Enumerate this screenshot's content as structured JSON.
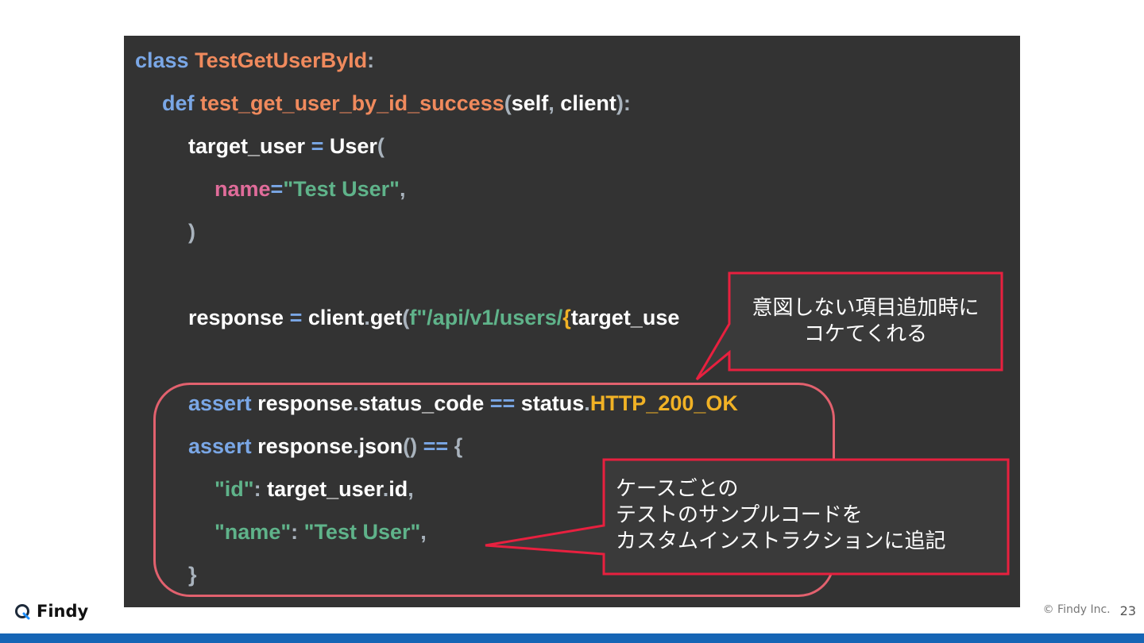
{
  "code": {
    "lines": [
      [
        {
          "t": "class ",
          "c": "kw"
        },
        {
          "t": "TestGetUserById",
          "c": "name"
        },
        {
          "t": ":",
          "c": "pun"
        }
      ],
      [
        {
          "t": "def ",
          "c": "kw"
        },
        {
          "t": "test_get_user_by_id_success",
          "c": "name"
        },
        {
          "t": "(",
          "c": "pun"
        },
        {
          "t": "self",
          "c": "wht"
        },
        {
          "t": ", ",
          "c": "pun"
        },
        {
          "t": "client",
          "c": "wht"
        },
        {
          "t": "):",
          "c": "pun"
        }
      ],
      [
        {
          "t": "target_user ",
          "c": "wht"
        },
        {
          "t": "= ",
          "c": "kw"
        },
        {
          "t": "User",
          "c": "wht"
        },
        {
          "t": "(",
          "c": "pun"
        }
      ],
      [
        {
          "t": "name",
          "c": "pink"
        },
        {
          "t": "=",
          "c": "kw"
        },
        {
          "t": "\"Test User\"",
          "c": "str"
        },
        {
          "t": ",",
          "c": "pun"
        }
      ],
      [
        {
          "t": ")",
          "c": "pun"
        }
      ],
      [],
      [
        {
          "t": "response ",
          "c": "wht"
        },
        {
          "t": "= ",
          "c": "kw"
        },
        {
          "t": "client",
          "c": "wht"
        },
        {
          "t": ".",
          "c": "pun"
        },
        {
          "t": "get",
          "c": "wht"
        },
        {
          "t": "(",
          "c": "pun"
        },
        {
          "t": "f\"/api/v1/users/",
          "c": "str"
        },
        {
          "t": "{",
          "c": "yel"
        },
        {
          "t": "target_use",
          "c": "wht"
        }
      ],
      [],
      [
        {
          "t": "assert ",
          "c": "kw"
        },
        {
          "t": "response",
          "c": "wht"
        },
        {
          "t": ".",
          "c": "pun"
        },
        {
          "t": "status_code ",
          "c": "wht"
        },
        {
          "t": "== ",
          "c": "kw"
        },
        {
          "t": "status",
          "c": "wht"
        },
        {
          "t": ".",
          "c": "pun"
        },
        {
          "t": "HTTP_200_OK",
          "c": "yel"
        }
      ],
      [
        {
          "t": "assert ",
          "c": "kw"
        },
        {
          "t": "response",
          "c": "wht"
        },
        {
          "t": ".",
          "c": "pun"
        },
        {
          "t": "json",
          "c": "wht"
        },
        {
          "t": "() ",
          "c": "pun"
        },
        {
          "t": "== ",
          "c": "kw"
        },
        {
          "t": "{",
          "c": "pun"
        }
      ],
      [
        {
          "t": "\"id\"",
          "c": "str"
        },
        {
          "t": ": ",
          "c": "pun"
        },
        {
          "t": "target_user",
          "c": "wht"
        },
        {
          "t": ".",
          "c": "pun"
        },
        {
          "t": "id",
          "c": "wht"
        },
        {
          "t": ",",
          "c": "pun"
        }
      ],
      [
        {
          "t": "\"name\"",
          "c": "str"
        },
        {
          "t": ": ",
          "c": "pun"
        },
        {
          "t": "\"Test User\"",
          "c": "str"
        },
        {
          "t": ",",
          "c": "pun"
        }
      ],
      [
        {
          "t": "}",
          "c": "pun"
        }
      ]
    ]
  },
  "callouts": {
    "top": {
      "lines": [
        "意図しない項目追加時に",
        "コケてくれる"
      ]
    },
    "bottom": {
      "lines": [
        "ケースごとの",
        "テストのサンプルコードを",
        "カスタムインストラクションに追記"
      ]
    }
  },
  "footer": {
    "logo_text": "Findy",
    "copyright": "© Findy Inc.",
    "page_number": "23"
  },
  "colors": {
    "code_background": "#333333",
    "highlight": "#e2616e",
    "callout_border": "#e8203f",
    "bottom_bar": "#1665b5"
  }
}
